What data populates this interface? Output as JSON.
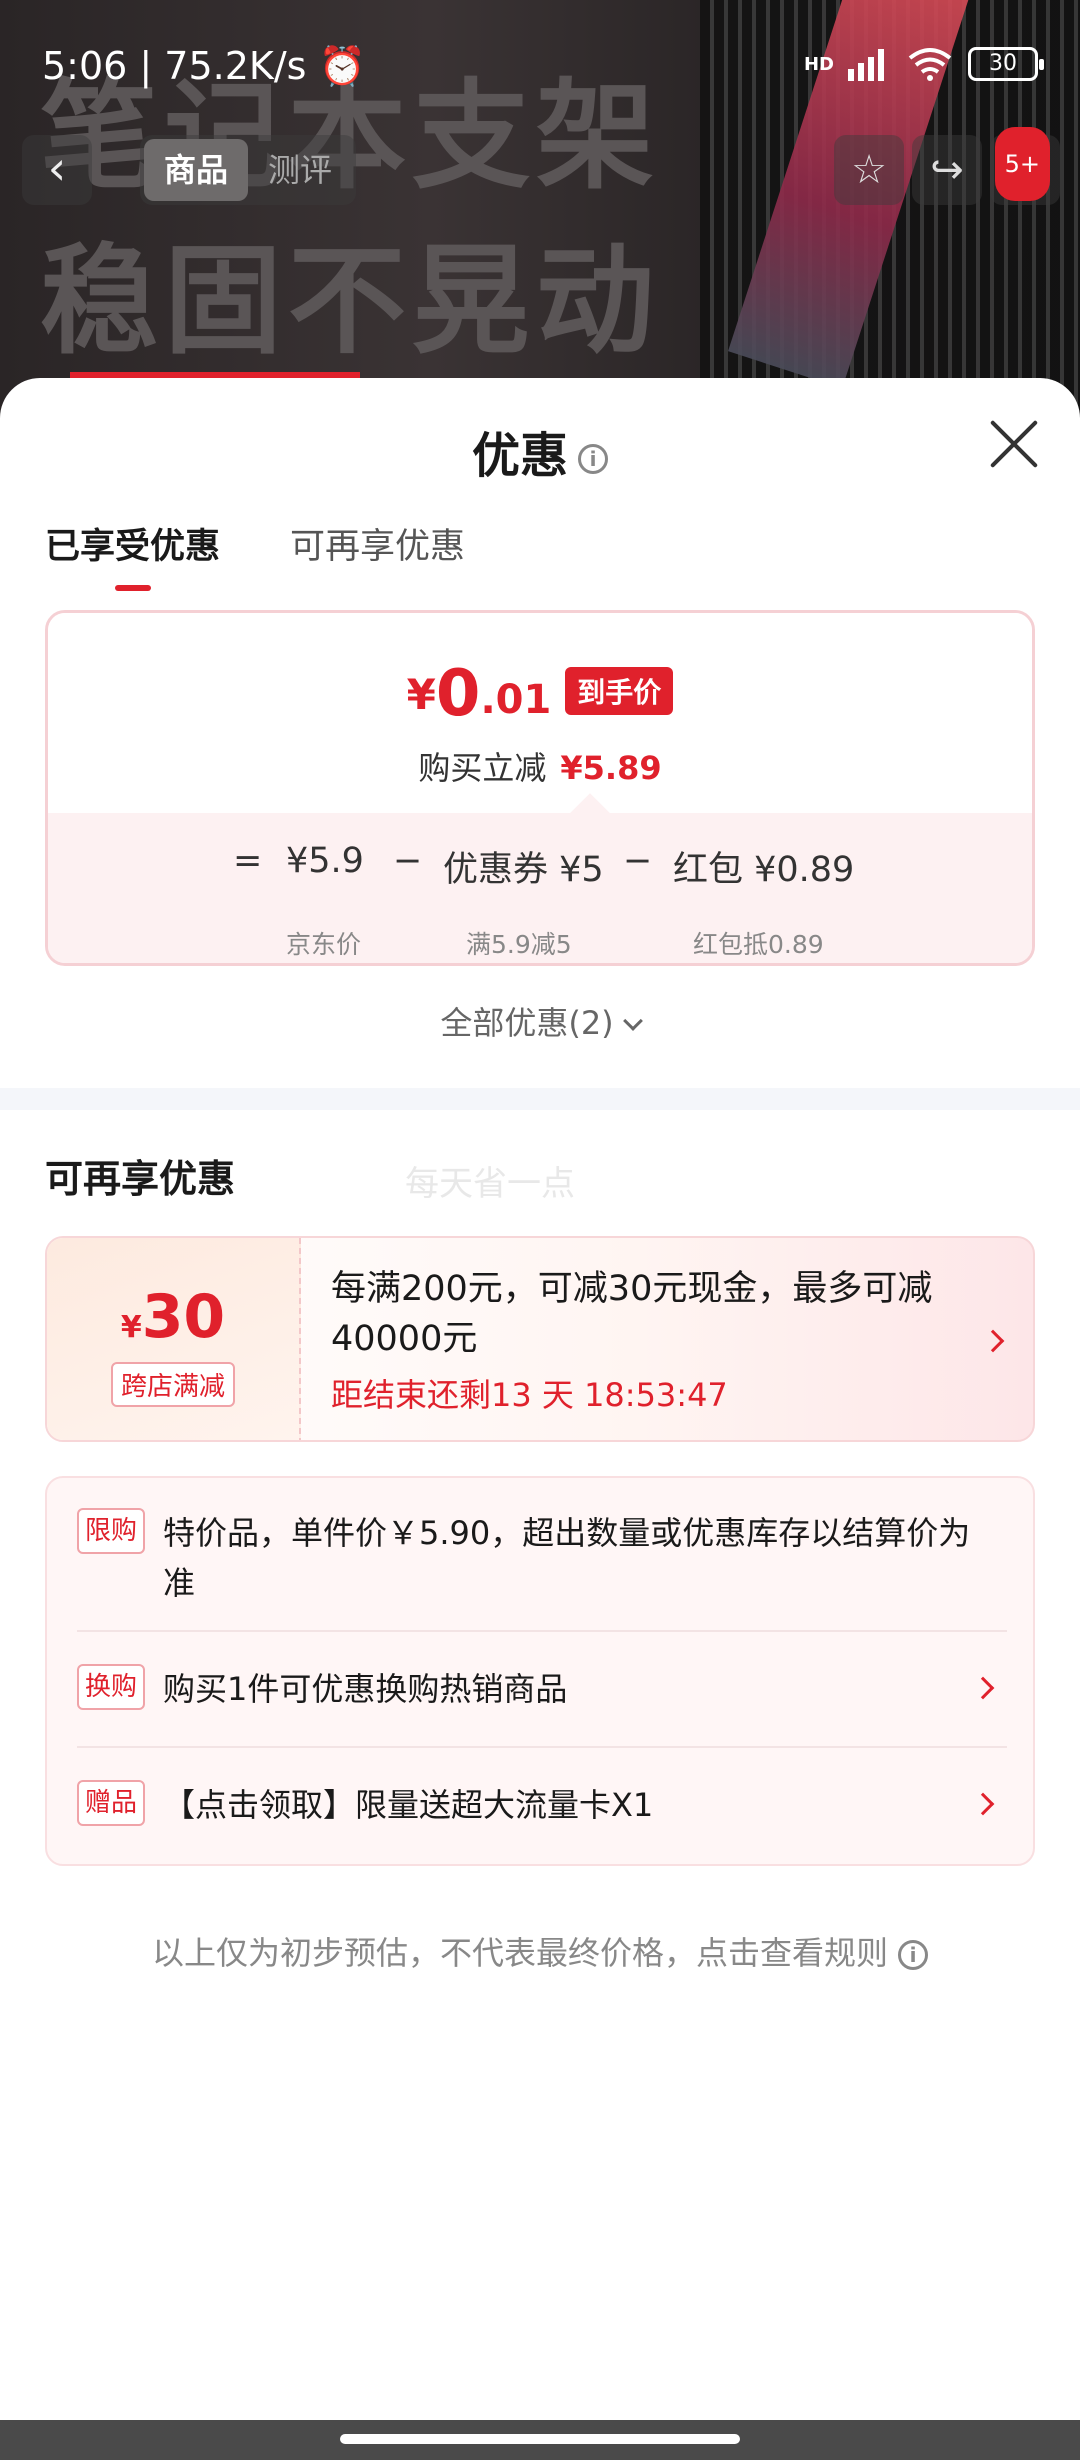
{
  "status_bar": {
    "time_speed": "5:06 | 75.2K/s",
    "alarm_icon": "alarm-icon",
    "signal": "HD",
    "battery": "30"
  },
  "hero": {
    "line1": "笔记本支架",
    "line2": "稳固不晃动"
  },
  "nav": {
    "back_icon": "←",
    "tabs": [
      "商品",
      "测评"
    ],
    "badge": "5+"
  },
  "sheet": {
    "title": "优惠",
    "tabs": [
      "已享受优惠",
      "可再享优惠"
    ]
  },
  "price": {
    "yen": "¥",
    "int": "0",
    "dec": ".01",
    "tag": "到手价",
    "sub_label": "购买立减",
    "sub_value": "¥5.89"
  },
  "formula": {
    "eq": "=",
    "base": "¥5.9",
    "minus1": "−",
    "coupon": "优惠券 ¥5",
    "minus2": "−",
    "redpack": "红包 ¥0.89",
    "base_sub": "京东价",
    "coupon_sub": "满5.9减5",
    "redpack_sub": "红包抵0.89"
  },
  "all_discount": "全部优惠(2)",
  "section": {
    "title": "可再享优惠",
    "watermark": "每天省一点"
  },
  "promo": {
    "yen": "¥",
    "amount": "30",
    "label": "跨店满减",
    "text": "每满200元，可减30元现金，最多可减40000元",
    "countdown": "距结束还剩13 天 18:53:47"
  },
  "list": [
    {
      "tag": "限购",
      "text": "特价品，单件价￥5.90，超出数量或优惠库存以结算价为准"
    },
    {
      "tag": "换购",
      "text": "购买1件可优惠换购热销商品"
    },
    {
      "tag": "赠品",
      "text": "【点击领取】限量送超大流量卡X1"
    }
  ],
  "footer_note": "以上仅为初步预估，不代表最终价格，点击查看规则",
  "colors": {
    "accent": "#e0212c",
    "sheet_bg": "#ffffff",
    "pink_bg": "#fdf1f2"
  }
}
